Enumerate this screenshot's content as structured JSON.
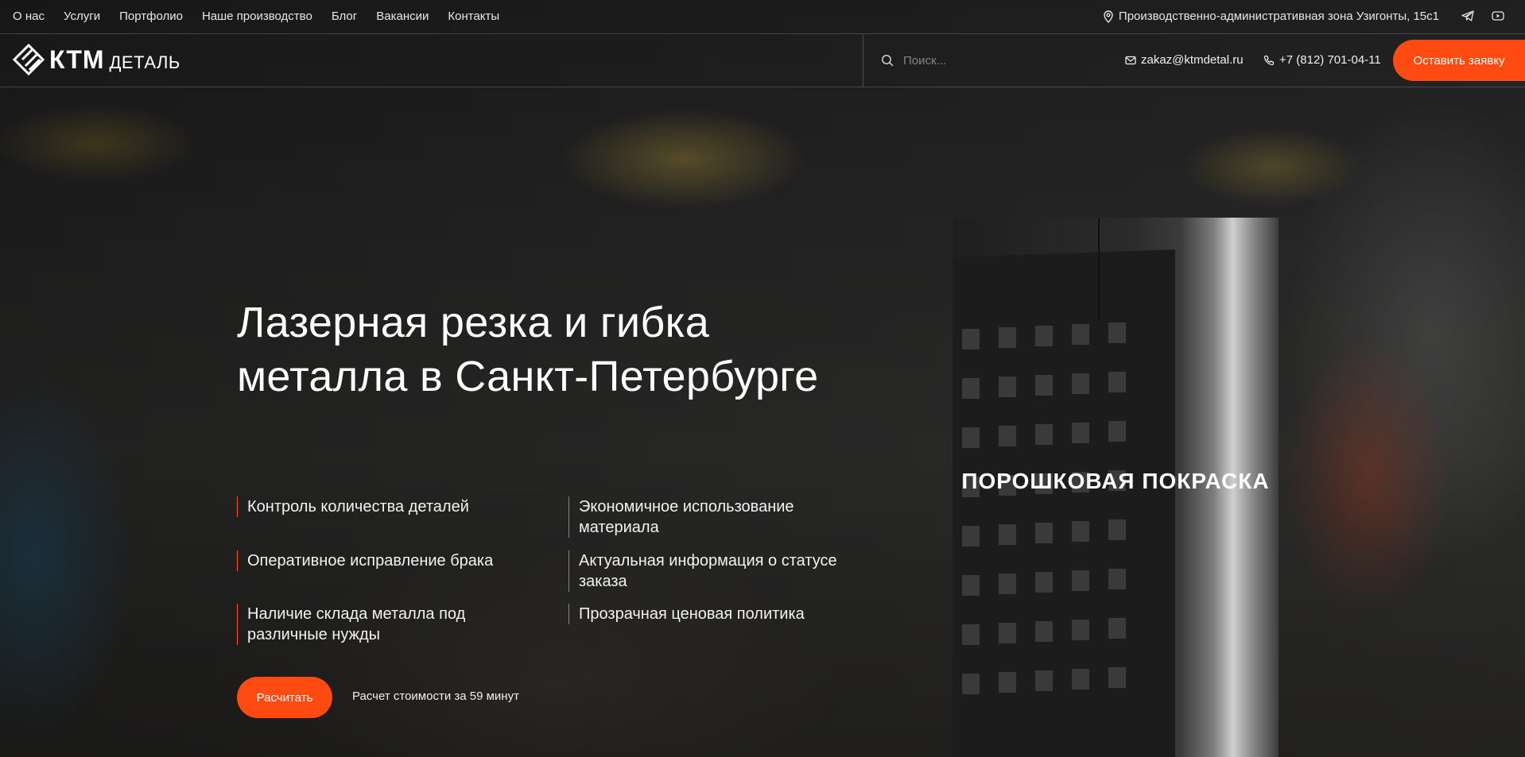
{
  "topnav": {
    "items": [
      "О нас",
      "Услуги",
      "Портфолио",
      "Наше производство",
      "Блог",
      "Вакансии",
      "Контакты"
    ],
    "address": "Производственно-административная зона Узигонты, 15с1",
    "social_icons": [
      "telegram-icon",
      "youtube-icon"
    ]
  },
  "header": {
    "logo_main": "КТМ",
    "logo_sub": "ДЕТАЛЬ",
    "search_placeholder": "Поиск...",
    "email": "zakaz@ktmdetal.ru",
    "phone": "+7 (812) 701-04-11",
    "request_button": "Оставить заявку"
  },
  "hero": {
    "title": "Лазерная резка и гибка металла в Санкт-Петербурге",
    "features": [
      "Контроль количества деталей",
      "Экономичное использование материала",
      "Оперативное исправление брака",
      "Актуальная информация о статусе заказа",
      "Наличие склада металла под различные нужды",
      "Прозрачная ценовая политика"
    ],
    "cta_button": "Расчитать",
    "cta_note": "Расчет стоимости за 59 минут"
  },
  "card": {
    "title": "ПОРОШКОВАЯ ПОКРАСКА"
  },
  "colors": {
    "accent": "#ff4a12"
  }
}
